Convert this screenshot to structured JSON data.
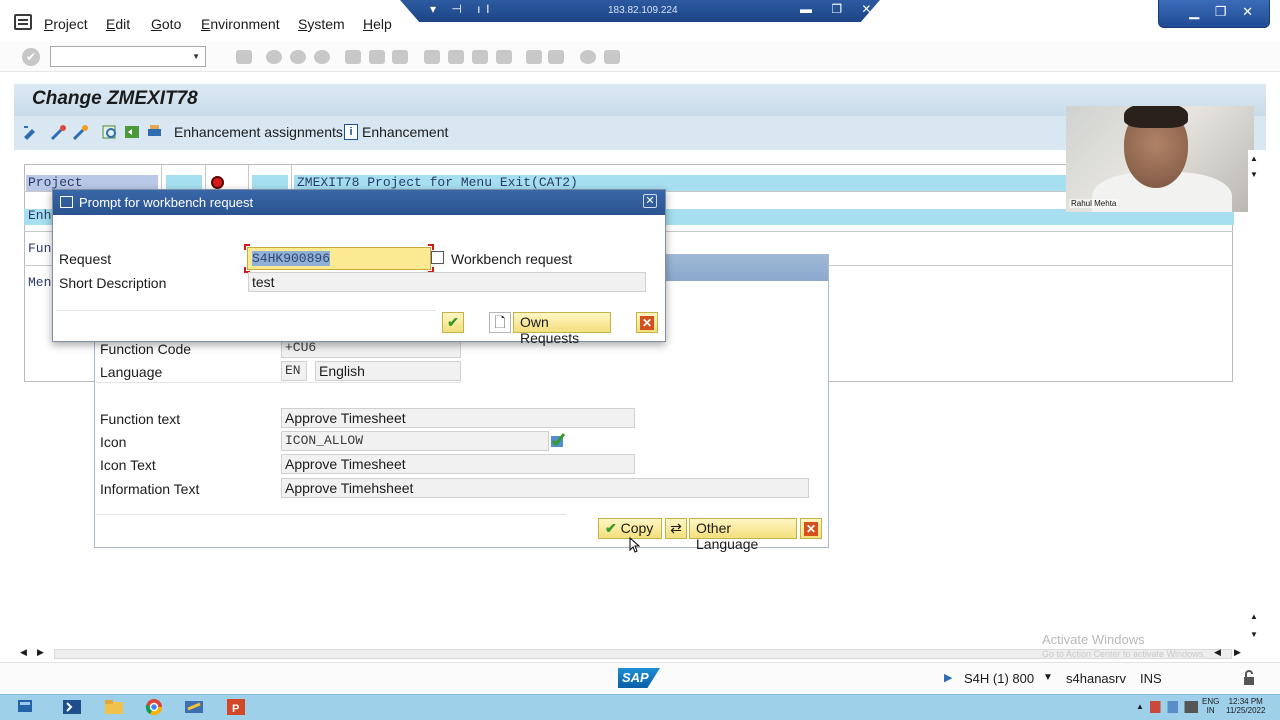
{
  "menu": {
    "items": [
      "Project",
      "Edit",
      "Goto",
      "Environment",
      "System",
      "Help"
    ]
  },
  "remote": {
    "ip": "183.82.109.224"
  },
  "page": {
    "title": "Change ZMEXIT78"
  },
  "app_toolbar": {
    "enhancement_assignments": "Enhancement assignments",
    "enhancement": "Enhancement"
  },
  "grid": {
    "project_label": "Project",
    "project_desc": "ZMEXIT78 Project for Menu Exit(CAT2)",
    "row2_label": "Enh",
    "row3_label": "Fun",
    "row4_label": "Men"
  },
  "under_dialog": {
    "function_code_label": "Function Code",
    "function_code_value": "+CU6",
    "language_label": "Language",
    "language_code": "EN",
    "language_name": "English",
    "function_text_label": "Function text",
    "function_text_value": "Approve Timesheet",
    "icon_label": "Icon",
    "icon_value": "ICON_ALLOW",
    "icon_text_label": "Icon Text",
    "icon_text_value": "Approve Timesheet",
    "info_text_label": "Information Text",
    "info_text_value": "Approve Timehsheet",
    "copy_label": "Copy",
    "other_language_label": "Other Language"
  },
  "prompt": {
    "title": "Prompt for workbench request",
    "request_label": "Request",
    "request_value": "S4HK900896",
    "request_type": "Workbench request",
    "short_desc_label": "Short Description",
    "short_desc_value": "test",
    "own_requests_label": "Own Requests"
  },
  "webcam": {
    "name": "Rahul Mehta"
  },
  "watermark": {
    "line1": "Activate Windows",
    "line2": "Go to Action Center to activate Windows."
  },
  "status": {
    "system": "S4H (1) 800",
    "server": "s4hanasrv",
    "mode": "INS",
    "sap_logo": "SAP"
  },
  "tray": {
    "lang1": "ENG",
    "lang2": "IN",
    "time": "12:34 PM",
    "date": "11/25/2022"
  },
  "colors": {
    "title_bar": "#c9dcea",
    "dialog_header": "#2a5390",
    "button_yellow": "#f3df7c",
    "highlight_cyan": "#a5dff0"
  }
}
